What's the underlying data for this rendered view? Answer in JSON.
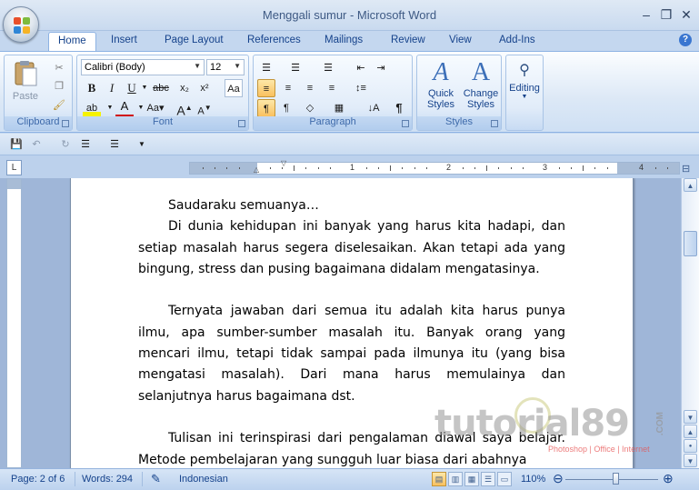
{
  "window": {
    "title": "Menggali sumur - Microsoft Word"
  },
  "tabs": [
    "Home",
    "Insert",
    "Page Layout",
    "References",
    "Mailings",
    "Review",
    "View",
    "Add-Ins"
  ],
  "ribbon": {
    "clipboard": {
      "label": "Clipboard",
      "paste": "Paste"
    },
    "font": {
      "label": "Font",
      "font_name": "Calibri (Body)",
      "font_size": "12"
    },
    "paragraph": {
      "label": "Paragraph"
    },
    "styles": {
      "label": "Styles",
      "quick_styles": "Quick\nStyles",
      "change_styles": "Change\nStyles"
    },
    "editing": {
      "label": "Editing"
    }
  },
  "document": {
    "paragraphs": [
      "Saudaraku semuanya…",
      "Di dunia kehidupan ini banyak yang harus kita hadapi, dan setiap masalah harus segera diselesaikan. Akan tetapi ada yang bingung, stress dan pusing bagaimana didalam mengatasinya.",
      "Ternyata jawaban dari semua itu adalah kita harus punya ilmu, apa sumber-sumber masalah itu. Banyak orang yang mencari ilmu, tetapi tidak sampai pada ilmunya itu (yang bisa mengatasi masalah). Dari mana harus memulainya dan selanjutnya harus bagaimana dst.",
      "Tulisan ini terinspirasi dari pengalaman diawal saya belajar. Metode pembelajaran yang sungguh luar biasa dari abahnya"
    ]
  },
  "watermark": {
    "text": "tutorial89",
    "sub": "Photoshop | Office | Internet",
    "com": ".COM"
  },
  "ruler": {
    "numbers": [
      "1",
      "2",
      "3",
      "4"
    ]
  },
  "status": {
    "page": "Page: 2 of 6",
    "words": "Words: 294",
    "language": "Indonesian",
    "zoom": "110%"
  },
  "colors": {
    "accent": "#15428b",
    "ribbon_bg": "#dce8f6",
    "doc_bg": "#9fb6d8"
  }
}
